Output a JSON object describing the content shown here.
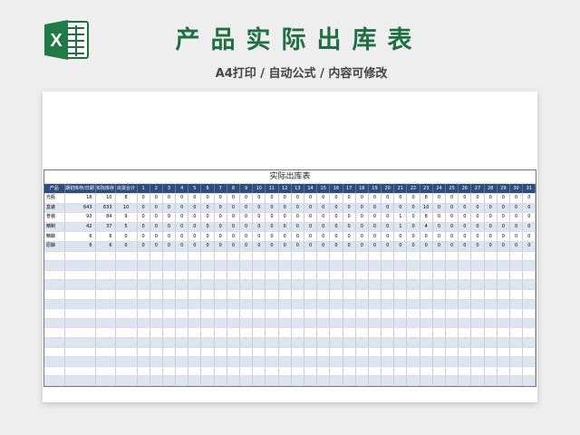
{
  "header": {
    "title": "产品实际出库表",
    "subtitle": "A4打印 / 自动公式 / 内容可修改",
    "brand_color": "#1f6f43",
    "logo_icon": "excel-icon"
  },
  "sheet": {
    "caption": "实际出库表",
    "header_color": "#2e4d7b",
    "alt_row_color": "#dde6f0",
    "columns": [
      "产品",
      "期初库存/日期",
      "实际库存",
      "出货合计",
      "1",
      "2",
      "3",
      "4",
      "5",
      "6",
      "7",
      "8",
      "9",
      "10",
      "11",
      "12",
      "13",
      "14",
      "15",
      "16",
      "17",
      "18",
      "19",
      "20",
      "21",
      "22",
      "23",
      "24",
      "25",
      "26",
      "27",
      "28",
      "29",
      "30",
      "31"
    ],
    "rows": [
      {
        "name": "光瓶",
        "opening": "18",
        "stock": "10",
        "total": "8",
        "days": [
          "0",
          "0",
          "0",
          "0",
          "0",
          "0",
          "0",
          "0",
          "0",
          "0",
          "0",
          "0",
          "0",
          "0",
          "0",
          "0",
          "0",
          "0",
          "0",
          "0",
          "0",
          "0",
          "8",
          "0",
          "0",
          "0",
          "0",
          "0",
          "0",
          "0",
          "0"
        ]
      },
      {
        "name": "盒装",
        "opening": "643",
        "stock": "633",
        "total": "10",
        "days": [
          "0",
          "0",
          "0",
          "0",
          "0",
          "0",
          "0",
          "0",
          "0",
          "0",
          "0",
          "0",
          "0",
          "0",
          "0",
          "0",
          "0",
          "0",
          "0",
          "0",
          "0",
          "0",
          "10",
          "0",
          "0",
          "0",
          "0",
          "0",
          "0",
          "0",
          "0"
        ]
      },
      {
        "name": "普装",
        "opening": "93",
        "stock": "84",
        "total": "9",
        "days": [
          "0",
          "0",
          "0",
          "0",
          "0",
          "0",
          "0",
          "0",
          "0",
          "0",
          "0",
          "0",
          "0",
          "0",
          "0",
          "0",
          "0",
          "0",
          "0",
          "0",
          "1",
          "0",
          "8",
          "0",
          "0",
          "0",
          "0",
          "0",
          "0",
          "0",
          "0"
        ]
      },
      {
        "name": "精制",
        "opening": "42",
        "stock": "37",
        "total": "5",
        "days": [
          "0",
          "0",
          "0",
          "0",
          "0",
          "0",
          "0",
          "0",
          "0",
          "0",
          "0",
          "0",
          "0",
          "0",
          "0",
          "0",
          "0",
          "0",
          "0",
          "0",
          "1",
          "0",
          "4",
          "0",
          "0",
          "0",
          "0",
          "0",
          "0",
          "0",
          "0"
        ]
      },
      {
        "name": "精酿",
        "opening": "6",
        "stock": "6",
        "total": "0",
        "days": [
          "0",
          "0",
          "0",
          "0",
          "0",
          "0",
          "0",
          "0",
          "0",
          "0",
          "0",
          "0",
          "0",
          "0",
          "0",
          "0",
          "0",
          "0",
          "0",
          "0",
          "0",
          "0",
          "0",
          "0",
          "0",
          "0",
          "0",
          "0",
          "0",
          "0",
          "0"
        ]
      },
      {
        "name": "原酿",
        "opening": "6",
        "stock": "6",
        "total": "0",
        "days": [
          "0",
          "0",
          "0",
          "0",
          "0",
          "0",
          "0",
          "0",
          "0",
          "0",
          "0",
          "0",
          "0",
          "0",
          "0",
          "0",
          "0",
          "0",
          "0",
          "0",
          "0",
          "0",
          "0",
          "0",
          "0",
          "0",
          "0",
          "0",
          "0",
          "0",
          "0"
        ]
      }
    ]
  }
}
